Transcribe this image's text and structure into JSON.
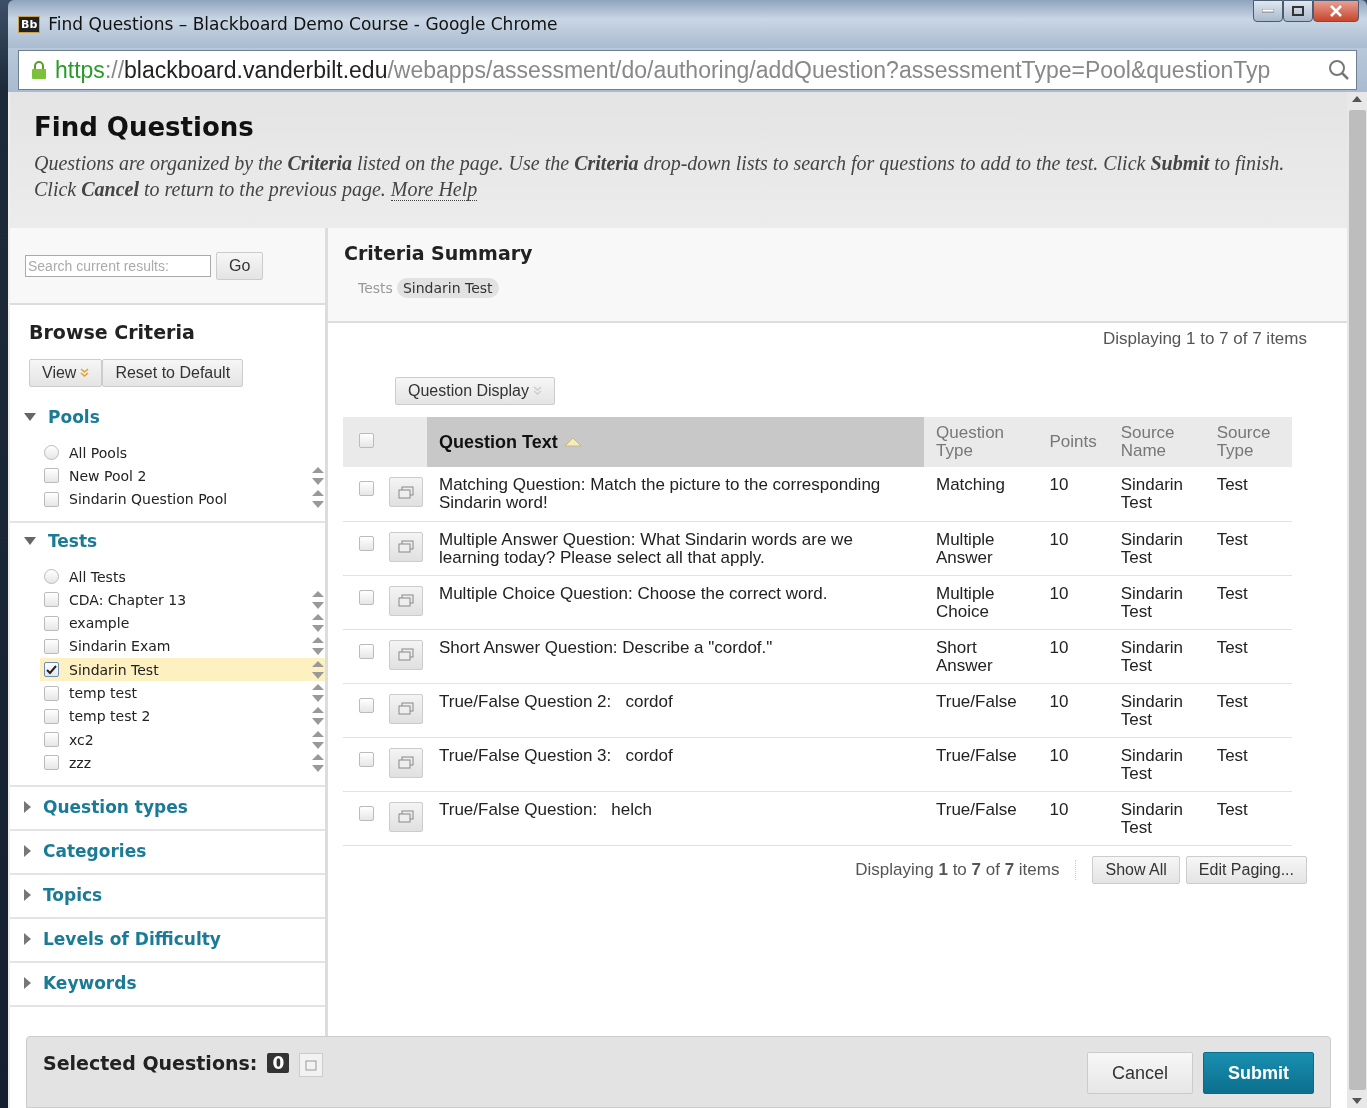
{
  "window": {
    "title": "Find Questions – Blackboard Demo Course - Google Chrome",
    "app_badge": "Bb"
  },
  "address_bar": {
    "scheme": "https",
    "separator": "://",
    "host": "blackboard.vanderbilt.edu",
    "path": "/webapps/assessment/do/authoring/addQuestion?assessmentType=Pool&questionTyp"
  },
  "page": {
    "title": "Find Questions",
    "description": "Questions are organized by the **Criteria** listed on the page. Use the **Criteria** drop-down lists to search for questions to add to the test. Click **Submit** to finish. Click **Cancel** to return to the previous page.",
    "help_link": "More Help"
  },
  "sidebar": {
    "search": {
      "placeholder": "Search current results:",
      "button": "Go"
    },
    "heading": "Browse Criteria",
    "view_button": "View",
    "reset_button": "Reset to Default",
    "sections": [
      {
        "label": "Pools",
        "expanded": true,
        "items": [
          {
            "kind": "radio",
            "label": "All Pools",
            "checked": false,
            "selected": false
          },
          {
            "kind": "checkbox",
            "label": "New Pool 2",
            "checked": false,
            "selected": false
          },
          {
            "kind": "checkbox",
            "label": "Sindarin Question Pool",
            "checked": false,
            "selected": false
          }
        ]
      },
      {
        "label": "Tests",
        "expanded": true,
        "items": [
          {
            "kind": "radio",
            "label": "All Tests",
            "checked": false,
            "selected": false
          },
          {
            "kind": "checkbox",
            "label": "CDA: Chapter 13",
            "checked": false,
            "selected": false
          },
          {
            "kind": "checkbox",
            "label": "example",
            "checked": false,
            "selected": false
          },
          {
            "kind": "checkbox",
            "label": "Sindarin Exam",
            "checked": false,
            "selected": false
          },
          {
            "kind": "checkbox",
            "label": "Sindarin Test",
            "checked": true,
            "selected": true
          },
          {
            "kind": "checkbox",
            "label": "temp test",
            "checked": false,
            "selected": false
          },
          {
            "kind": "checkbox",
            "label": "temp test 2",
            "checked": false,
            "selected": false
          },
          {
            "kind": "checkbox",
            "label": "xc2",
            "checked": false,
            "selected": false
          },
          {
            "kind": "checkbox",
            "label": "zzz",
            "checked": false,
            "selected": false
          }
        ]
      },
      {
        "label": "Question types",
        "expanded": false
      },
      {
        "label": "Categories",
        "expanded": false
      },
      {
        "label": "Topics",
        "expanded": false
      },
      {
        "label": "Levels of Difficulty",
        "expanded": false
      },
      {
        "label": "Keywords",
        "expanded": false
      }
    ]
  },
  "summary": {
    "heading": "Criteria Summary",
    "filter_label": "Tests",
    "filter_tag": "Sindarin Test"
  },
  "results": {
    "top_count": "Displaying 1 to 7 of 7 items",
    "display_button": "Question Display",
    "table": {
      "select_all_checked": false,
      "columns": [
        "Question Text",
        "Question Type",
        "Points",
        "Source Name",
        "Source Type"
      ],
      "rows": [
        {
          "text": "Matching Question: Match the picture to the corresponding Sindarin word!",
          "type": "Matching",
          "points": "10",
          "source_name": "Sindarin Test",
          "source_type": "Test",
          "checked": false
        },
        {
          "text": "Multiple Answer Question: What Sindarin words are we learning today? Please select all that apply.",
          "type": "Multiple Answer",
          "points": "10",
          "source_name": "Sindarin Test",
          "source_type": "Test",
          "checked": false
        },
        {
          "text": "Multiple Choice Question: Choose the correct word.",
          "type": "Multiple Choice",
          "points": "10",
          "source_name": "Sindarin Test",
          "source_type": "Test",
          "checked": false
        },
        {
          "text": "Short Answer Question: Describe a \"cordof.\"",
          "type": "Short Answer",
          "points": "10",
          "source_name": "Sindarin Test",
          "source_type": "Test",
          "checked": false
        },
        {
          "text": "True/False Question 2:   cordof",
          "type": "True/False",
          "points": "10",
          "source_name": "Sindarin Test",
          "source_type": "Test",
          "checked": false
        },
        {
          "text": "True/False Question 3:   cordof",
          "type": "True/False",
          "points": "10",
          "source_name": "Sindarin Test",
          "source_type": "Test",
          "checked": false
        },
        {
          "text": "True/False Question:   helch",
          "type": "True/False",
          "points": "10",
          "source_name": "Sindarin Test",
          "source_type": "Test",
          "checked": false
        }
      ]
    },
    "bottom_count": "Displaying **1** to **7** of **7** items",
    "show_all_button": "Show All",
    "edit_paging_button": "Edit Paging..."
  },
  "footer": {
    "label": "Selected Questions:",
    "count": "0",
    "cancel_button": "Cancel",
    "submit_button": "Submit"
  }
}
